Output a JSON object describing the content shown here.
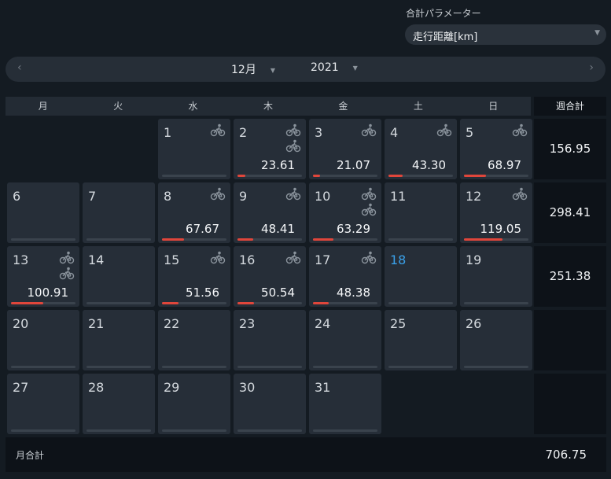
{
  "parameter": {
    "label": "合計パラメーター",
    "selected": "走行距離[km]"
  },
  "navigation": {
    "month": "12月",
    "year": "2021"
  },
  "weekdays": [
    "月",
    "火",
    "水",
    "木",
    "金",
    "土",
    "日"
  ],
  "week_total_header": "週合計",
  "bar_scale_max": 200,
  "colors": {
    "bar": "#e0463b",
    "today": "#3aa0e8",
    "cell": "#262e38"
  },
  "days": [
    {
      "day": "1",
      "value": "",
      "num": 0,
      "rides": 1,
      "today": false
    },
    {
      "day": "2",
      "value": "23.61",
      "num": 23.61,
      "rides": 2,
      "today": false
    },
    {
      "day": "3",
      "value": "21.07",
      "num": 21.07,
      "rides": 1,
      "today": false
    },
    {
      "day": "4",
      "value": "43.30",
      "num": 43.3,
      "rides": 1,
      "today": false
    },
    {
      "day": "5",
      "value": "68.97",
      "num": 68.97,
      "rides": 1,
      "today": false
    },
    {
      "day": "6",
      "value": "",
      "num": 0,
      "rides": 0,
      "today": false
    },
    {
      "day": "7",
      "value": "",
      "num": 0,
      "rides": 0,
      "today": false
    },
    {
      "day": "8",
      "value": "67.67",
      "num": 67.67,
      "rides": 1,
      "today": false
    },
    {
      "day": "9",
      "value": "48.41",
      "num": 48.41,
      "rides": 1,
      "today": false
    },
    {
      "day": "10",
      "value": "63.29",
      "num": 63.29,
      "rides": 2,
      "today": false
    },
    {
      "day": "11",
      "value": "",
      "num": 0,
      "rides": 0,
      "today": false
    },
    {
      "day": "12",
      "value": "119.05",
      "num": 119.05,
      "rides": 1,
      "today": false
    },
    {
      "day": "13",
      "value": "100.91",
      "num": 100.91,
      "rides": 2,
      "today": false
    },
    {
      "day": "14",
      "value": "",
      "num": 0,
      "rides": 0,
      "today": false
    },
    {
      "day": "15",
      "value": "51.56",
      "num": 51.56,
      "rides": 1,
      "today": false
    },
    {
      "day": "16",
      "value": "50.54",
      "num": 50.54,
      "rides": 1,
      "today": false
    },
    {
      "day": "17",
      "value": "48.38",
      "num": 48.38,
      "rides": 1,
      "today": false
    },
    {
      "day": "18",
      "value": "",
      "num": 0,
      "rides": 0,
      "today": true
    },
    {
      "day": "19",
      "value": "",
      "num": 0,
      "rides": 0,
      "today": false
    },
    {
      "day": "20",
      "value": "",
      "num": 0,
      "rides": 0,
      "today": false
    },
    {
      "day": "21",
      "value": "",
      "num": 0,
      "rides": 0,
      "today": false
    },
    {
      "day": "22",
      "value": "",
      "num": 0,
      "rides": 0,
      "today": false
    },
    {
      "day": "23",
      "value": "",
      "num": 0,
      "rides": 0,
      "today": false
    },
    {
      "day": "24",
      "value": "",
      "num": 0,
      "rides": 0,
      "today": false
    },
    {
      "day": "25",
      "value": "",
      "num": 0,
      "rides": 0,
      "today": false
    },
    {
      "day": "26",
      "value": "",
      "num": 0,
      "rides": 0,
      "today": false
    },
    {
      "day": "27",
      "value": "",
      "num": 0,
      "rides": 0,
      "today": false
    },
    {
      "day": "28",
      "value": "",
      "num": 0,
      "rides": 0,
      "today": false
    },
    {
      "day": "29",
      "value": "",
      "num": 0,
      "rides": 0,
      "today": false
    },
    {
      "day": "30",
      "value": "",
      "num": 0,
      "rides": 0,
      "today": false
    },
    {
      "day": "31",
      "value": "",
      "num": 0,
      "rides": 0,
      "today": false
    }
  ],
  "week_totals": [
    "156.95",
    "298.41",
    "251.38",
    "",
    ""
  ],
  "footer": {
    "label": "月合計",
    "total": "706.75"
  }
}
